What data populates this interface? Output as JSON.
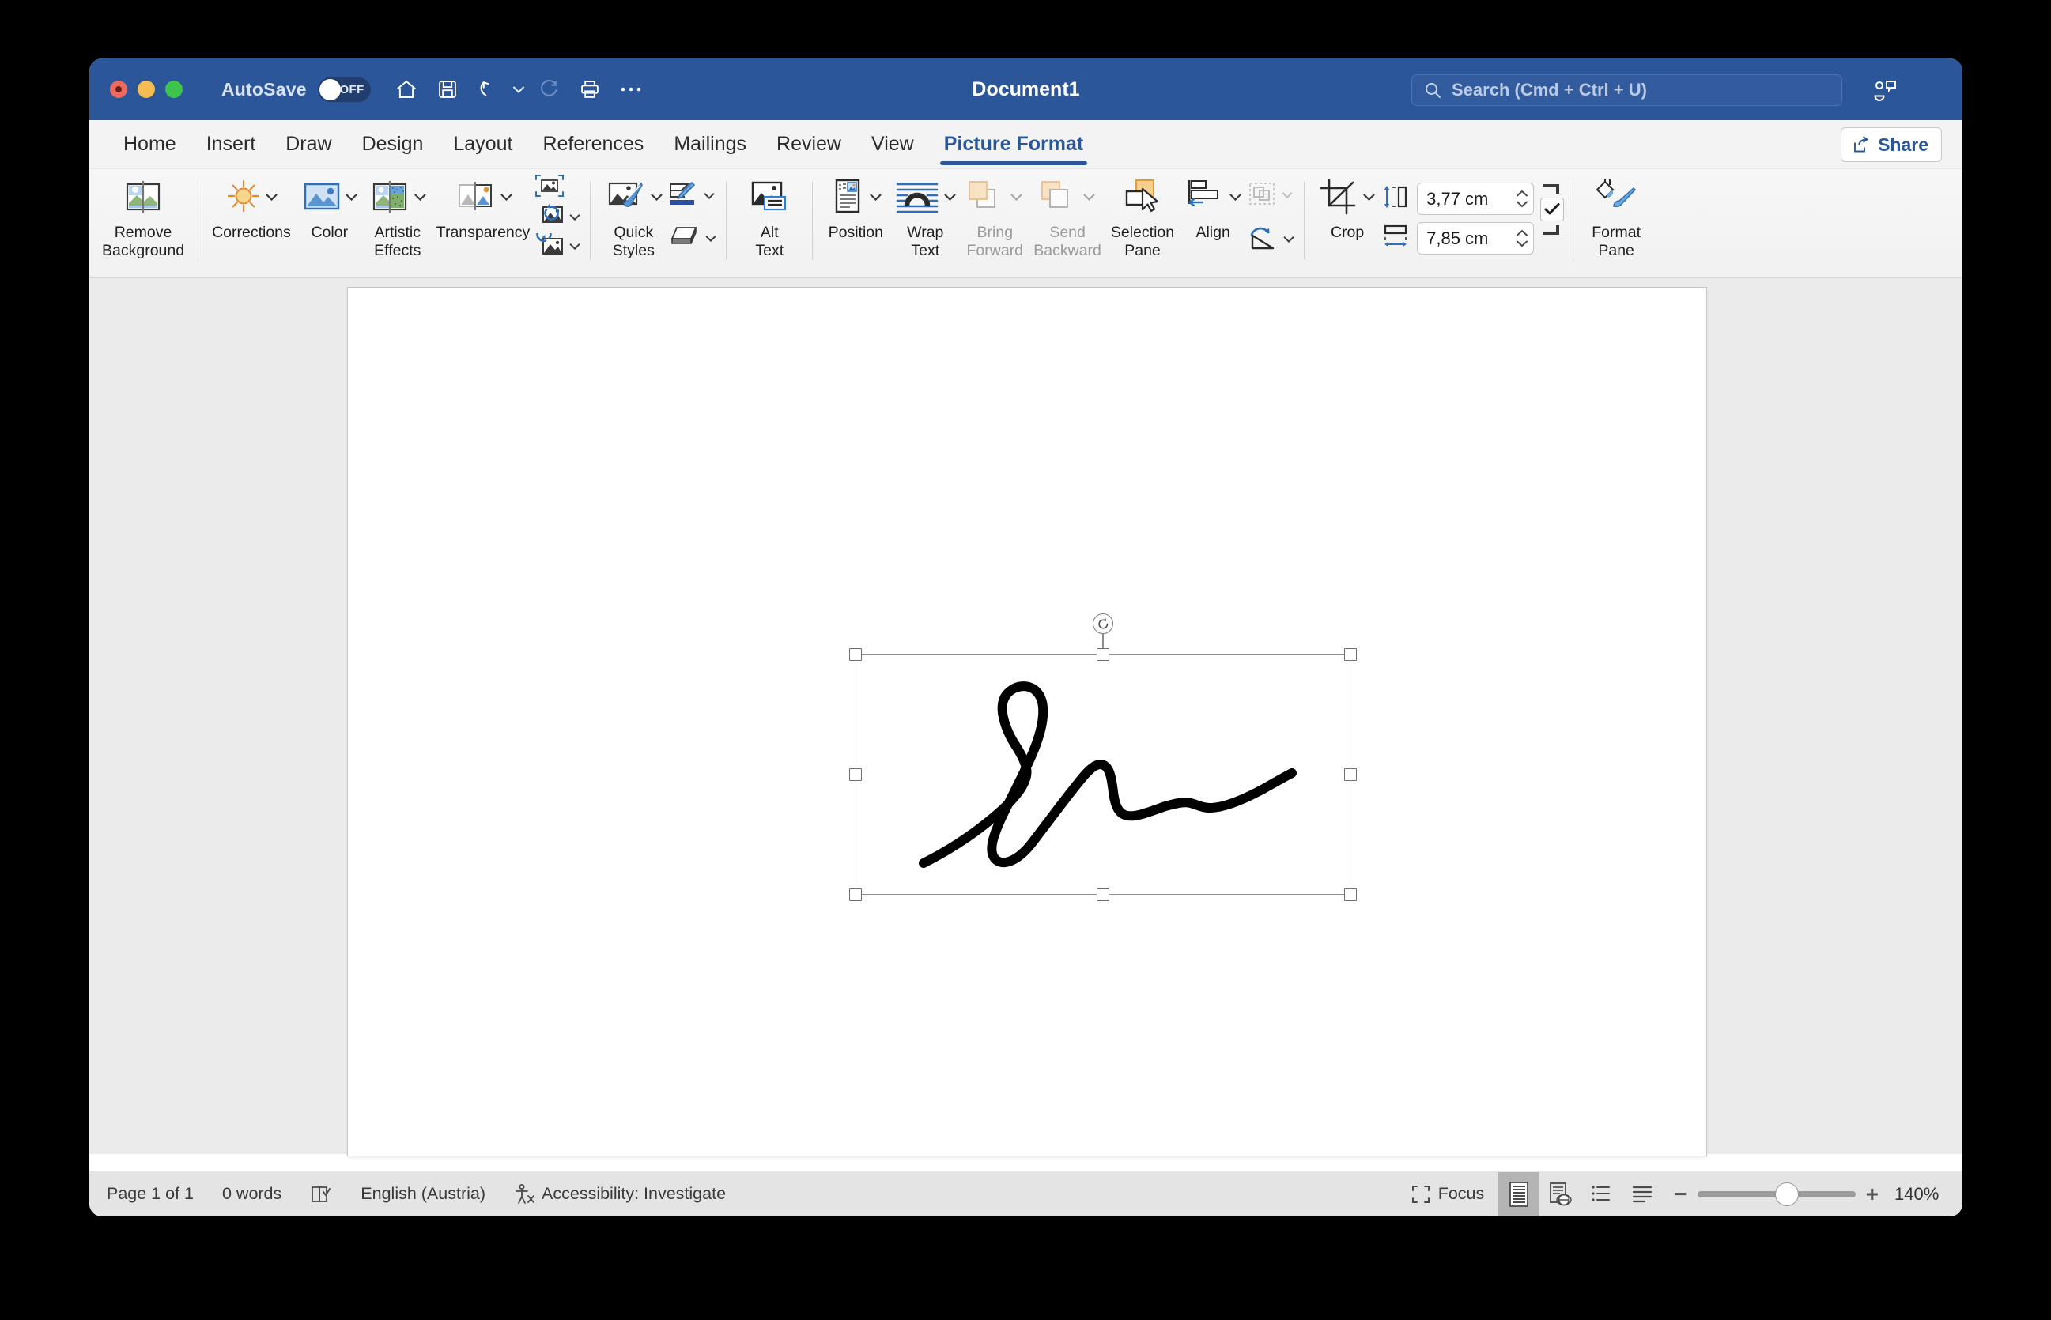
{
  "window": {
    "title": "Document1",
    "autosave": {
      "label": "AutoSave",
      "state": "OFF"
    },
    "traffic_lights": [
      "close",
      "minimize",
      "zoom"
    ],
    "quick_access": [
      {
        "name": "home-icon",
        "tooltip": "Home"
      },
      {
        "name": "save-icon",
        "tooltip": "Save"
      },
      {
        "name": "undo-icon",
        "tooltip": "Undo"
      },
      {
        "name": "redo-icon",
        "tooltip": "Redo"
      },
      {
        "name": "print-icon",
        "tooltip": "Print"
      },
      {
        "name": "more-icon",
        "tooltip": "More"
      }
    ],
    "search": {
      "placeholder": "Search (Cmd + Ctrl + U)",
      "icon": "search-icon"
    },
    "collab_icon": "collaborators-icon",
    "accent_color": "#2b579a",
    "titlebar_color": "#2b579a"
  },
  "tabs": [
    {
      "label": "Home",
      "active": false
    },
    {
      "label": "Insert",
      "active": false
    },
    {
      "label": "Draw",
      "active": false
    },
    {
      "label": "Design",
      "active": false
    },
    {
      "label": "Layout",
      "active": false
    },
    {
      "label": "References",
      "active": false
    },
    {
      "label": "Mailings",
      "active": false
    },
    {
      "label": "Review",
      "active": false
    },
    {
      "label": "View",
      "active": false
    },
    {
      "label": "Picture Format",
      "active": true
    }
  ],
  "share": {
    "label": "Share",
    "icon": "share-icon"
  },
  "ribbon": {
    "remove_background": {
      "label_line1": "Remove",
      "label_line2": "Background",
      "icon": "remove-background-icon"
    },
    "corrections": {
      "label": "Corrections",
      "icon": "corrections-sun-icon",
      "has_caret": true
    },
    "color": {
      "label": "Color",
      "icon": "color-picture-icon",
      "has_caret": true
    },
    "artistic_effects": {
      "label_line1": "Artistic",
      "label_line2": "Effects",
      "icon": "artistic-effects-icon",
      "has_caret": true
    },
    "transparency": {
      "label": "Transparency",
      "icon": "transparency-icon",
      "has_caret": true
    },
    "compress_pictures": {
      "icon": "compress-pictures-icon"
    },
    "change_picture": {
      "icon": "change-picture-icon",
      "has_caret": true
    },
    "reset_picture": {
      "icon": "reset-picture-icon",
      "has_caret": true
    },
    "quick_styles": {
      "label_line1": "Quick",
      "label_line2": "Styles",
      "icon": "quick-styles-icon",
      "has_caret": true
    },
    "picture_border": {
      "icon": "picture-border-icon",
      "has_caret": true
    },
    "picture_effects": {
      "icon": "picture-effects-icon",
      "has_caret": true
    },
    "alt_text": {
      "label_line1": "Alt",
      "label_line2": "Text",
      "icon": "alt-text-icon"
    },
    "position": {
      "label": "Position",
      "icon": "position-icon",
      "has_caret": true
    },
    "wrap_text": {
      "label_line1": "Wrap",
      "label_line2": "Text",
      "icon": "wrap-text-icon",
      "has_caret": true
    },
    "bring_forward": {
      "label_line1": "Bring",
      "label_line2": "Forward",
      "icon": "bring-forward-icon",
      "has_caret": true,
      "disabled": true
    },
    "send_backward": {
      "label_line1": "Send",
      "label_line2": "Backward",
      "icon": "send-backward-icon",
      "has_caret": true,
      "disabled": true
    },
    "selection_pane": {
      "label_line1": "Selection",
      "label_line2": "Pane",
      "icon": "selection-pane-icon"
    },
    "align": {
      "label": "Align",
      "icon": "align-icon",
      "has_caret": true
    },
    "group": {
      "icon": "group-objects-icon",
      "has_caret": true,
      "disabled": true
    },
    "rotate": {
      "icon": "rotate-objects-icon",
      "has_caret": true
    },
    "crop": {
      "label": "Crop",
      "icon": "crop-icon",
      "has_caret": true
    },
    "height": {
      "icon": "shape-height-icon",
      "value": "3,77 cm"
    },
    "width": {
      "icon": "shape-width-icon",
      "value": "7,85 cm"
    },
    "lock_aspect": {
      "icon": "lock-aspect-ratio-icon",
      "checked": true
    },
    "format_pane": {
      "label_line1": "Format",
      "label_line2": "Pane",
      "icon": "format-pane-icon"
    }
  },
  "document": {
    "selected_object": {
      "type": "picture",
      "alt": "handwritten-signature",
      "rotate_handle_icon": "rotate-handle-icon",
      "handles": 8
    }
  },
  "statusbar": {
    "page": "Page 1 of 1",
    "words": "0 words",
    "proofing_icon": "proofing-icon",
    "language": "English (Austria)",
    "accessibility_icon": "accessibility-icon",
    "accessibility": "Accessibility: Investigate",
    "focus": {
      "label": "Focus",
      "icon": "focus-icon"
    },
    "views": [
      {
        "name": "print-layout-view",
        "icon": "print-layout-icon",
        "active": true
      },
      {
        "name": "web-layout-view",
        "icon": "web-layout-icon",
        "active": false
      },
      {
        "name": "outline-view",
        "icon": "outline-icon",
        "active": false
      },
      {
        "name": "draft-view",
        "icon": "draft-icon",
        "active": false
      }
    ],
    "zoom": {
      "minus": "−",
      "plus": "+",
      "value": "140%",
      "percent": 140
    }
  }
}
